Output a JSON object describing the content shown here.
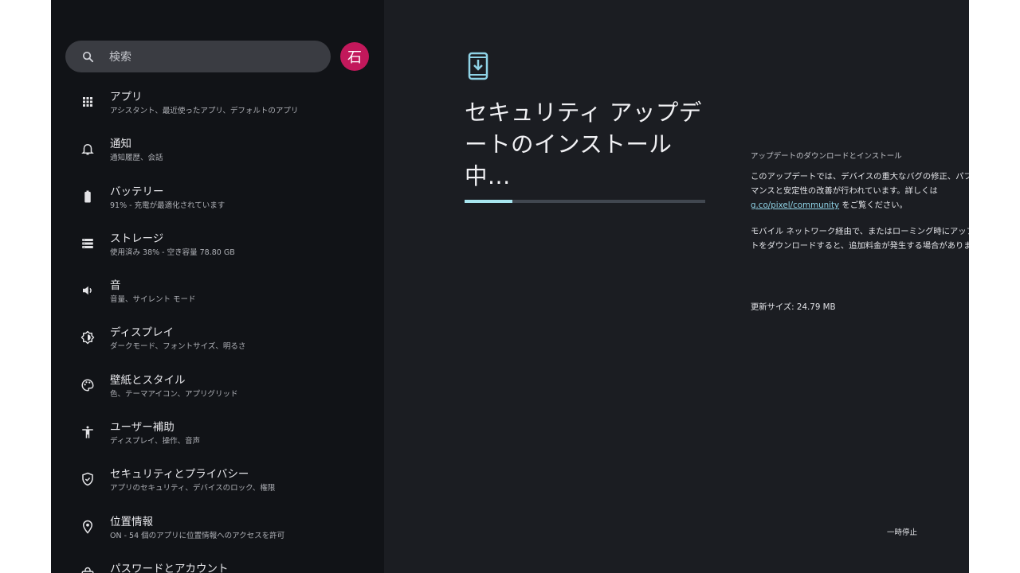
{
  "search": {
    "placeholder": "検索"
  },
  "account": {
    "avatar_letter": "石",
    "avatar_color": "#c2185b"
  },
  "settings_items": [
    {
      "icon": "apps-grid-icon",
      "title": "アプリ",
      "subtitle": "アシスタント、最近使ったアプリ、デフォルトのアプリ"
    },
    {
      "icon": "bell-icon",
      "title": "通知",
      "subtitle": "通知履歴、会話"
    },
    {
      "icon": "battery-icon",
      "title": "バッテリー",
      "subtitle": "91% - 充電が最適化されています"
    },
    {
      "icon": "storage-icon",
      "title": "ストレージ",
      "subtitle": "使用済み 38% - 空き容量 78.80 GB"
    },
    {
      "icon": "volume-icon",
      "title": "音",
      "subtitle": "音量、サイレント モード"
    },
    {
      "icon": "display-brightness-icon",
      "title": "ディスプレイ",
      "subtitle": "ダークモード、フォントサイズ、明るさ"
    },
    {
      "icon": "palette-icon",
      "title": "壁紙とスタイル",
      "subtitle": "色、テーマアイコン、アプリグリッド"
    },
    {
      "icon": "accessibility-icon",
      "title": "ユーザー補助",
      "subtitle": "ディスプレイ、操作、音声"
    },
    {
      "icon": "shield-icon",
      "title": "セキュリティとプライバシー",
      "subtitle": "アプリのセキュリティ、デバイスのロック、権限"
    },
    {
      "icon": "location-pin-icon",
      "title": "位置情報",
      "subtitle": "ON - 54 個のアプリに位置情報へのアクセスを許可"
    },
    {
      "icon": "key-icon",
      "title": "パスワードとアカウント",
      "subtitle": ""
    }
  ],
  "update": {
    "icon": "phone-download-icon",
    "title": "セキュリティ アップデートのインストール中...",
    "progress": 0.2,
    "accent_color": "#a8e6f0",
    "section_title": "アップデートのダウンロードとインストール",
    "desc1_before": "このアップデートでは、デバイスの重大なバグの修正、パフォーマンスと安定性の改善が行われています。詳しくは ",
    "desc1_link": "g.co/pixel/community",
    "desc1_after": " をご覧ください。",
    "desc2": "モバイル ネットワーク経由で、またはローミング時にアップデートをダウンロードすると、追加料金が発生する場合があります。",
    "size_label": "更新サイズ: 24.79 MB",
    "pause_label": "一時停止"
  }
}
